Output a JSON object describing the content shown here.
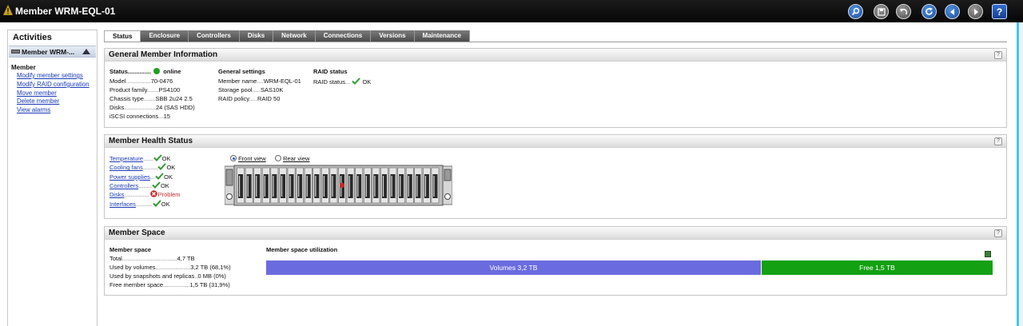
{
  "window": {
    "title": "Member WRM-EQL-01"
  },
  "toolbar": {
    "icons": [
      "search-icon",
      "save-icon",
      "undo-icon",
      "refresh-icon",
      "back-icon",
      "forward-icon",
      "help-icon"
    ],
    "help_label": "?"
  },
  "activities": {
    "title": "Activities",
    "selected_item": "Member WRM-...",
    "group_label": "Member",
    "links": [
      "Modify member settings",
      "Modify RAID configuration",
      "Move member",
      "Delete member",
      "View alarms"
    ]
  },
  "tabs": [
    "Status",
    "Enclosure",
    "Controllers",
    "Disks",
    "Network",
    "Connections",
    "Versions",
    "Maintenance"
  ],
  "general": {
    "title": "General Member Information",
    "help": "?",
    "status_label": "Status..............",
    "status_value": "online",
    "status_color": "#20a020",
    "rows": [
      {
        "label": "Model",
        "dots": "...............",
        "value": "70-0476"
      },
      {
        "label": "Product family",
        "dots": ".......",
        "value": "PS4100"
      },
      {
        "label": "Chassis type",
        "dots": ".......",
        "value": "SBB 2u24 2.5"
      },
      {
        "label": "Disks",
        "dots": "...................",
        "value": "24 (SAS HDD)"
      },
      {
        "label": "iSCSI connections",
        "dots": "...",
        "value": "15"
      }
    ],
    "settings_title": "General settings",
    "settings_rows": [
      {
        "label": "Member name",
        "dots": "....",
        "value": "WRM-EQL-01"
      },
      {
        "label": "Storage pool",
        "dots": ".....",
        "value": "SAS10K"
      },
      {
        "label": "RAID policy",
        "dots": ".....",
        "value": "RAID 50"
      }
    ],
    "raid_title": "RAID status",
    "raid_label": "RAID status",
    "raid_dots": "...",
    "raid_value": "OK"
  },
  "health": {
    "title": "Member Health Status",
    "help": "?",
    "items": [
      {
        "label": "Temperature",
        "dots": "......",
        "value": "OK",
        "status": "ok"
      },
      {
        "label": "Cooling fans",
        "dots": ".........",
        "value": "OK",
        "status": "ok"
      },
      {
        "label": "Power supplies",
        "dots": "...",
        "value": "OK",
        "status": "ok"
      },
      {
        "label": "Controllers",
        "dots": "........",
        "value": "OK",
        "status": "ok"
      },
      {
        "label": "Disks",
        "dots": "...............",
        "value": "Problem",
        "status": "problem"
      },
      {
        "label": "Interfaces",
        "dots": "..........",
        "value": "OK",
        "status": "ok"
      }
    ],
    "front_view": "Front view",
    "rear_view": "Rear view",
    "disk_count": 24,
    "problem_disk_index": 12,
    "ok_color": "#2f9a2f",
    "problem_color": "#c82828"
  },
  "space": {
    "title": "Member Space",
    "help": "?",
    "left_title": "Member space",
    "rows": [
      {
        "label": "Total",
        "dots": ".................................",
        "value": "4,7 TB"
      },
      {
        "label": "Used by volumes",
        "dots": ".....................",
        "value": "3,2 TB (68,1%)"
      },
      {
        "label": "Used by snapshots and replicas",
        "dots": "..",
        "value": "0 MB (0%)"
      },
      {
        "label": "Free member space",
        "dots": "................",
        "value": "1,5 TB (31,9%)"
      }
    ],
    "util_title": "Member space utilization",
    "volumes_label": "Volumes 3,2 TB",
    "free_label": "Free 1,5 TB",
    "volumes_fraction": 0.681,
    "volumes_color": "#6b6be0",
    "free_color": "#13a013"
  }
}
